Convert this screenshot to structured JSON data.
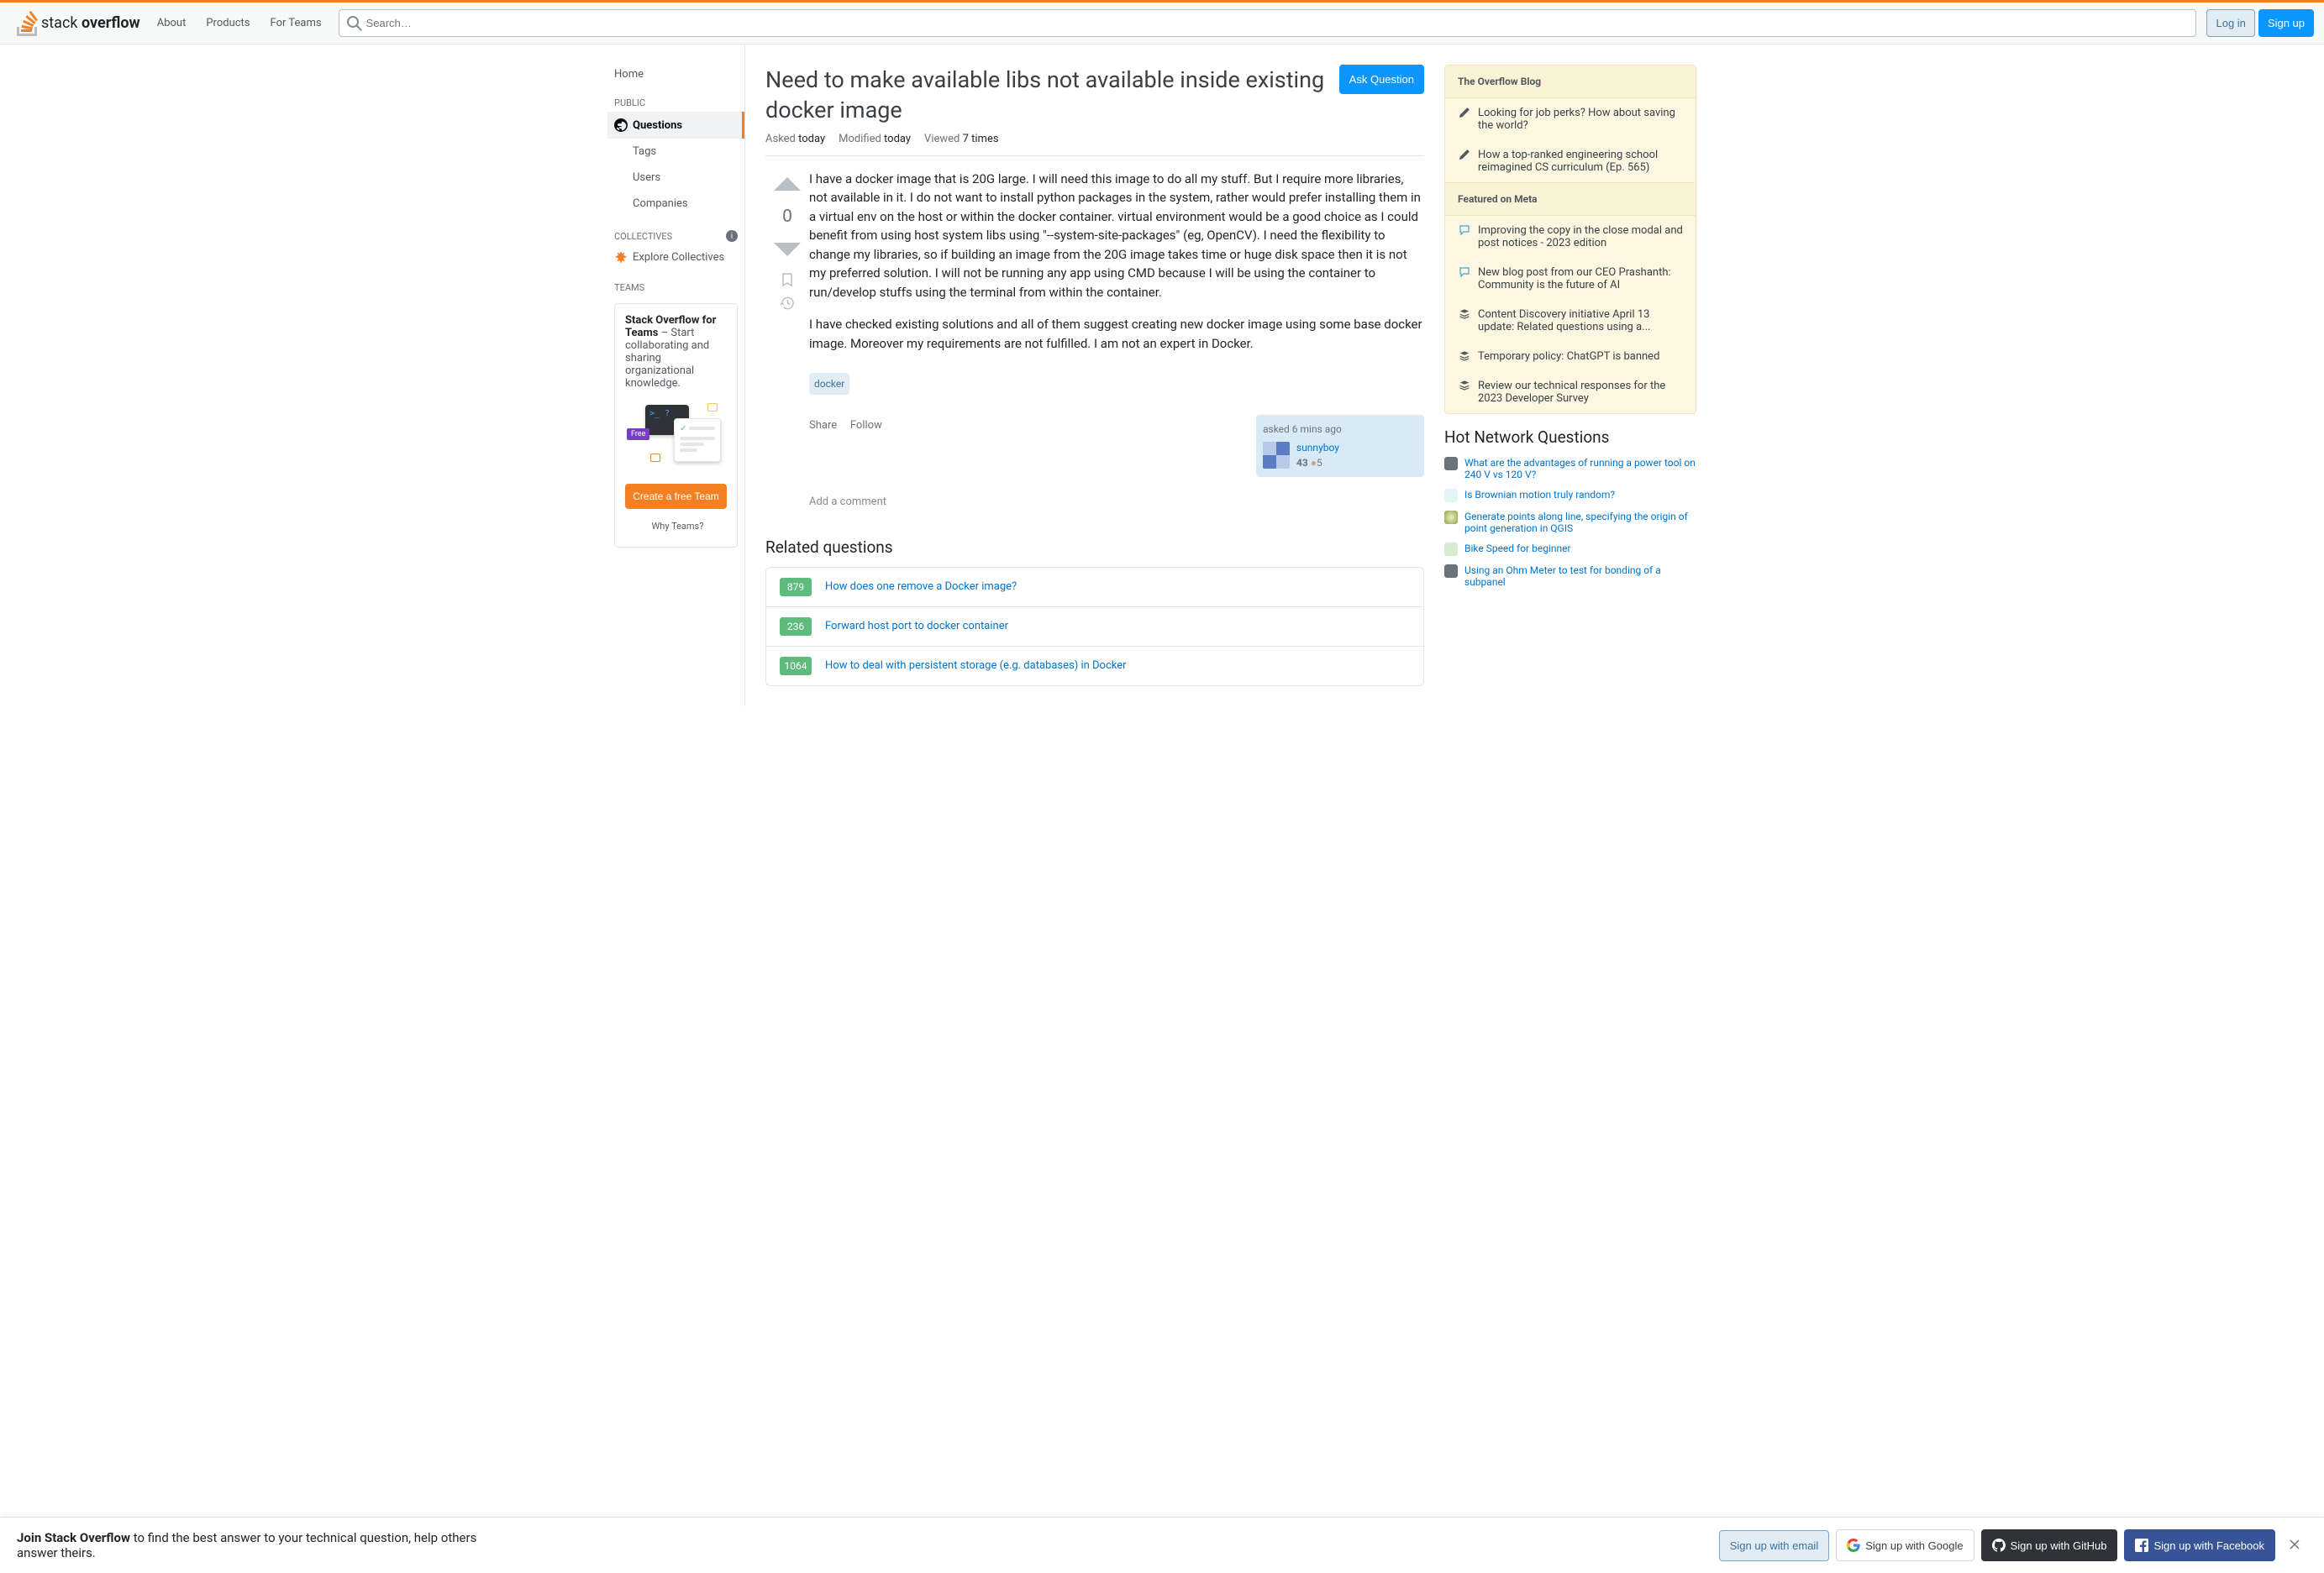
{
  "header": {
    "nav": {
      "about": "About",
      "products": "Products",
      "teams": "For Teams"
    },
    "search_placeholder": "Search…",
    "login": "Log in",
    "signup": "Sign up"
  },
  "sidebar": {
    "home": "Home",
    "public_label": "PUBLIC",
    "questions": "Questions",
    "tags": "Tags",
    "users": "Users",
    "companies": "Companies",
    "collectives_label": "COLLECTIVES",
    "explore": "Explore Collectives",
    "teams_label": "TEAMS",
    "teams_card_title": "Stack Overflow for Teams",
    "teams_card_body": " – Start collaborating and sharing organizational knowledge.",
    "free_label": "Free",
    "create_team": "Create a free Team",
    "why_teams": "Why Teams?"
  },
  "question": {
    "title": "Need to make available libs not available inside existing docker image",
    "ask_button": "Ask Question",
    "meta": {
      "asked_label": "Asked",
      "asked_val": "today",
      "modified_label": "Modified",
      "modified_val": "today",
      "viewed_label": "Viewed",
      "viewed_val": "7 times"
    },
    "vote_count": "0",
    "body_p1": "I have a docker image that is 20G large. I will need this image to do all my stuff. But I require more libraries, not available in it. I do not want to install python packages in the system, rather would prefer installing them in a virtual env on the host or within the docker container. virtual environment would be a good choice as I could benefit from using host system libs using \"--system-site-packages\" (eg, OpenCV). I need the flexibility to change my libraries, so if building an image from the 20G image takes time or huge disk space then it is not my preferred solution. I will not be running any app using CMD because I will be using the container to run/develop stuffs using the terminal from within the container.",
    "body_p2": "I have checked existing solutions and all of them suggest creating new docker image using some base docker image. Moreover my requirements are not fulfilled. I am not an expert in Docker.",
    "tag": "docker",
    "share": "Share",
    "follow": "Follow",
    "asked_ago": "asked 6 mins ago",
    "username": "sunnyboy",
    "rep": "43",
    "bronze": "5",
    "add_comment": "Add a comment"
  },
  "related": {
    "heading": "Related questions",
    "items": [
      {
        "score": "879",
        "title": "How does one remove a Docker image?"
      },
      {
        "score": "236",
        "title": "Forward host port to docker container"
      },
      {
        "score": "1064",
        "title": "How to deal with persistent storage (e.g. databases) in Docker"
      }
    ]
  },
  "bulletin": {
    "blog_head": "The Overflow Blog",
    "blog_items": [
      "Looking for job perks? How about saving the world?",
      "How a top-ranked engineering school reimagined CS curriculum (Ep. 565)"
    ],
    "meta_head": "Featured on Meta",
    "meta_items": [
      "Improving the copy in the close modal and post notices - 2023 edition",
      "New blog post from our CEO Prashanth: Community is the future of AI",
      "Content Discovery initiative April 13 update: Related questions using a...",
      "Temporary policy: ChatGPT is banned",
      "Review our technical responses for the 2023 Developer Survey"
    ]
  },
  "hot": {
    "heading": "Hot Network Questions",
    "items": [
      "What are the advantages of running a power tool on 240 V vs 120 V?",
      "Is Brownian motion truly random?",
      "Generate points along line, specifying the origin of point generation in QGIS",
      "Bike Speed for beginner",
      "Using an Ohm Meter to test for bonding of a subpanel"
    ]
  },
  "banner": {
    "text_bold": "Join Stack Overflow",
    "text_rest": " to find the best answer to your technical question, help others answer theirs.",
    "email": "Sign up with email",
    "google": "Sign up with Google",
    "github": "Sign up with GitHub",
    "facebook": "Sign up with Facebook"
  }
}
